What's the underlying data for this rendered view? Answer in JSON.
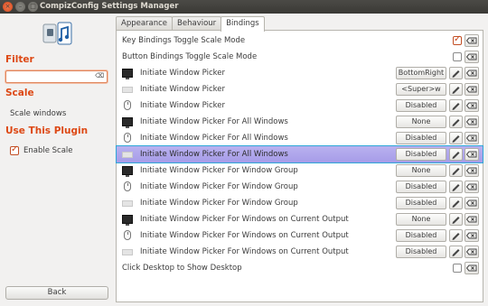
{
  "window": {
    "title": "CompizConfig Settings Manager",
    "close_glyph": "×",
    "min_glyph": "–",
    "max_glyph": "□"
  },
  "sidebar": {
    "filter_heading": "Filter",
    "filter_value": "",
    "filter_clear_glyph": "⌫",
    "scale_heading": "Scale",
    "scale_item": "Scale windows",
    "use_heading": "Use This Plugin",
    "enable_label": "Enable Scale",
    "enable_checked": true,
    "back_label": "Back"
  },
  "tabs": [
    {
      "label": "Appearance",
      "active": false
    },
    {
      "label": "Behaviour",
      "active": false
    },
    {
      "label": "Bindings",
      "active": true
    }
  ],
  "rows": [
    {
      "icon": "none",
      "label": "Key Bindings Toggle Scale Mode",
      "control": "checkbox",
      "checked": true
    },
    {
      "icon": "none",
      "label": "Button Bindings Toggle Scale Mode",
      "control": "checkbox",
      "checked": false
    },
    {
      "icon": "monitor-icon",
      "label": "Initiate Window Picker",
      "control": "binding",
      "value": "BottomRight"
    },
    {
      "icon": "screen-edge-icon",
      "label": "Initiate Window Picker",
      "control": "binding",
      "value": "<Super>w"
    },
    {
      "icon": "mouse-icon",
      "label": "Initiate Window Picker",
      "control": "binding",
      "value": "Disabled"
    },
    {
      "icon": "monitor-icon",
      "label": "Initiate Window Picker For All Windows",
      "control": "binding",
      "value": "None"
    },
    {
      "icon": "mouse-icon",
      "label": "Initiate Window Picker For All Windows",
      "control": "binding",
      "value": "Disabled"
    },
    {
      "icon": "screen-edge-icon",
      "label": "Initiate Window Picker For All Windows",
      "control": "binding",
      "value": "Disabled",
      "selected": true
    },
    {
      "icon": "monitor-icon",
      "label": "Initiate Window Picker For Window Group",
      "control": "binding",
      "value": "None"
    },
    {
      "icon": "mouse-icon",
      "label": "Initiate Window Picker For Window Group",
      "control": "binding",
      "value": "Disabled"
    },
    {
      "icon": "screen-edge-icon",
      "label": "Initiate Window Picker For Window Group",
      "control": "binding",
      "value": "Disabled"
    },
    {
      "icon": "monitor-icon",
      "label": "Initiate Window Picker For Windows on Current Output",
      "control": "binding",
      "value": "None"
    },
    {
      "icon": "mouse-icon",
      "label": "Initiate Window Picker For Windows on Current Output",
      "control": "binding",
      "value": "Disabled"
    },
    {
      "icon": "screen-edge-icon",
      "label": "Initiate Window Picker For Windows on Current Output",
      "control": "binding",
      "value": "Disabled"
    },
    {
      "icon": "none",
      "label": "Click Desktop to Show Desktop",
      "control": "checkbox",
      "checked": false
    }
  ],
  "colors": {
    "accent": "#dd4814",
    "selection": "#a69ce8",
    "selection_outline": "#2ea7d8"
  }
}
